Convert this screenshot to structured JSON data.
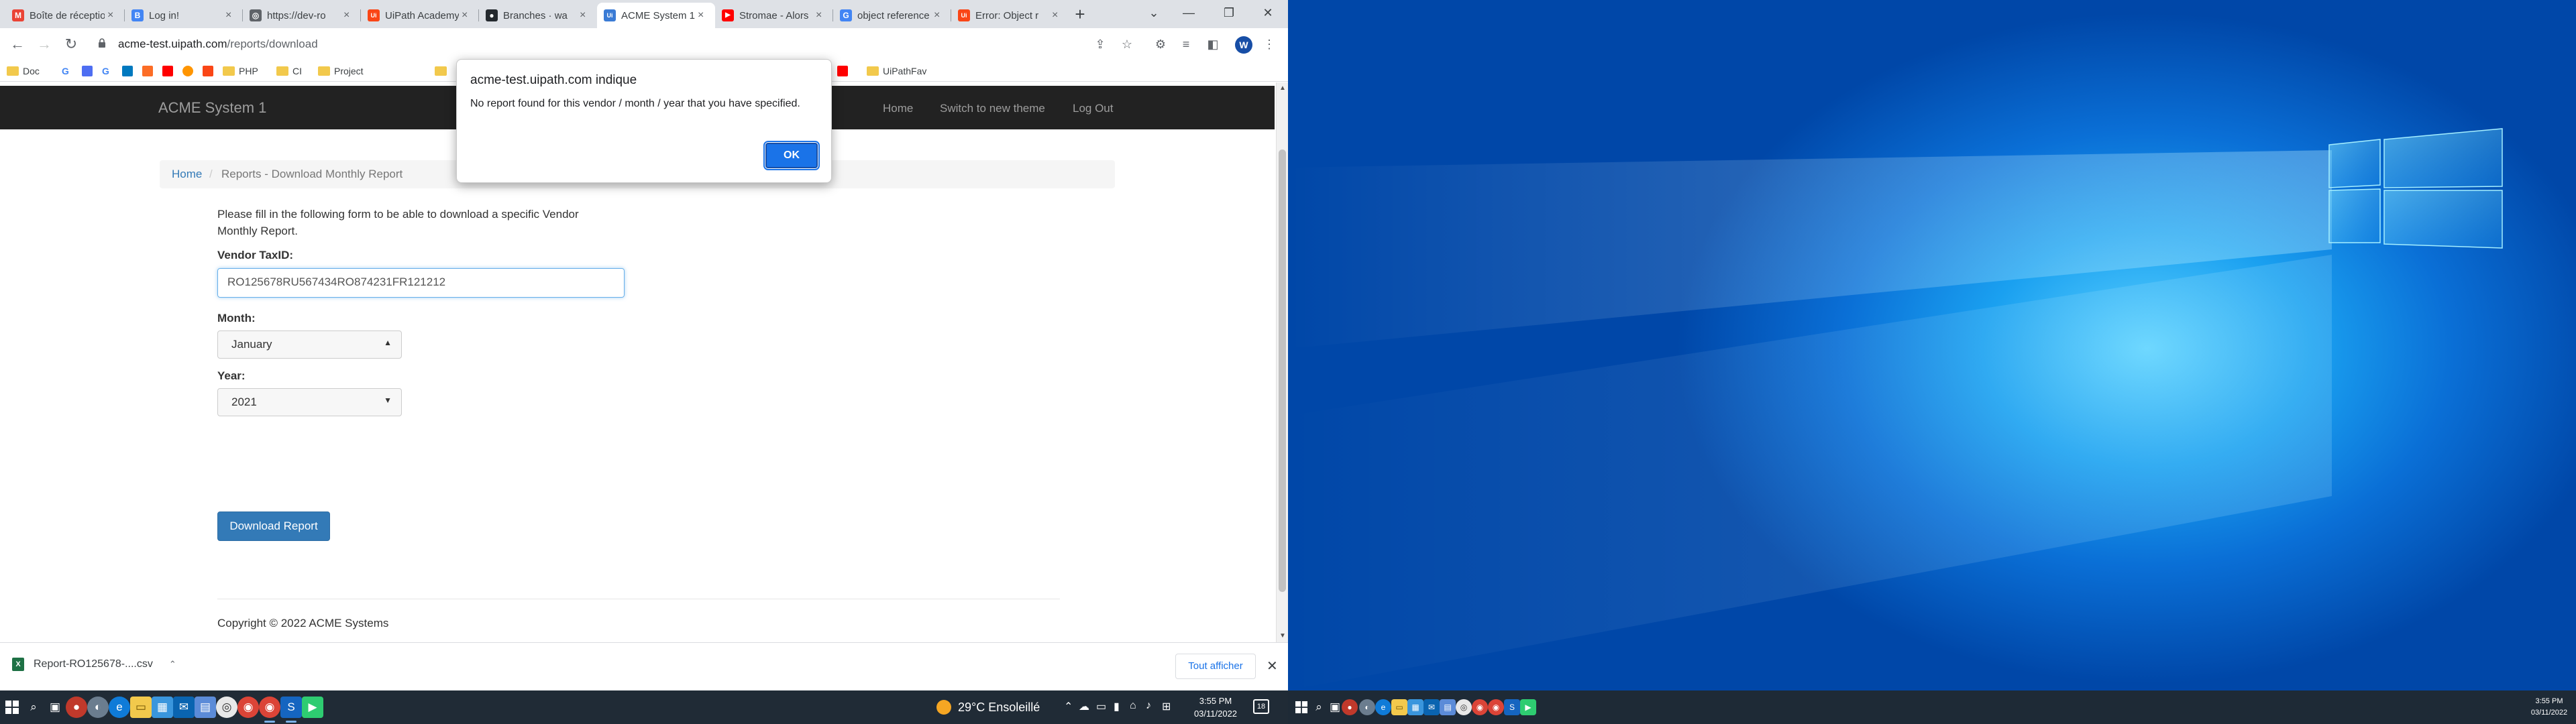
{
  "browser": {
    "tabs": [
      {
        "title": "Boîte de réception",
        "icon": "gmail-icon",
        "color": "#ea4335",
        "glyph": "M"
      },
      {
        "title": "Log in!",
        "icon": "app-icon",
        "color": "#4285f4",
        "glyph": "B"
      },
      {
        "title": "https://dev-ro",
        "icon": "globe-icon",
        "color": "#5f6368",
        "glyph": "◎"
      },
      {
        "title": "UiPath Academy",
        "icon": "uipath-icon",
        "color": "#fa4616",
        "glyph": "Ui"
      },
      {
        "title": "Branches · wa",
        "icon": "github-icon",
        "color": "#24292e",
        "glyph": "●"
      },
      {
        "title": "ACME System 1",
        "icon": "acme-icon",
        "color": "#3a7bd5",
        "glyph": "Ui"
      },
      {
        "title": "Stromae - Alors",
        "icon": "youtube-icon",
        "color": "#ff0000",
        "glyph": "▶"
      },
      {
        "title": "object reference",
        "icon": "google-icon",
        "color": "#4285f4",
        "glyph": "G"
      },
      {
        "title": "Error: Object r",
        "icon": "uipath-icon",
        "color": "#fa4616",
        "glyph": "Ui"
      }
    ],
    "window_controls": {
      "tab_search": "⌄",
      "minimize": "—",
      "restore": "❐",
      "close": "✕"
    },
    "url_host": "acme-test.uipath.com",
    "url_path": "/reports/download",
    "avatar_letter": "W",
    "bookmarks": [
      "Doc",
      "PHP",
      "CI",
      "Project",
      "UiPathFav"
    ]
  },
  "site": {
    "brand": "ACME System 1",
    "nav": [
      "Home",
      "Switch to new theme",
      "Log Out"
    ],
    "breadcrumb": {
      "home": "Home",
      "separator": "/",
      "current": "Reports - Download Monthly Report"
    },
    "intro": "Please fill in the following form to be able to download a specific Vendor Monthly Report.",
    "vendor_label": "Vendor TaxID:",
    "vendor_value": "RO125678RU567434RO874231FR121212",
    "month_label": "Month:",
    "month_value": "January",
    "year_label": "Year:",
    "year_value": "2021",
    "download_button": "Download Report",
    "copyright": "Copyright © 2022 ACME Systems"
  },
  "alert": {
    "title": "acme-test.uipath.com indique",
    "message": "No report found for this vendor / month / year that you have specified.",
    "ok": "OK"
  },
  "downloads": {
    "file": "Report-RO125678-....csv",
    "show_all": "Tout afficher"
  },
  "taskbar_left": {
    "weather": "29°C  Ensoleillé",
    "time": "3:55 PM",
    "date": "03/11/2022",
    "notifications": "18"
  },
  "taskbar_right": {
    "time": "3:55 PM",
    "date": "03/11/2022"
  },
  "colors": {
    "accent": "#337ab7",
    "dialog_button": "#1a73e8",
    "navbar": "#222222",
    "desktop": "#0a6fd6"
  }
}
